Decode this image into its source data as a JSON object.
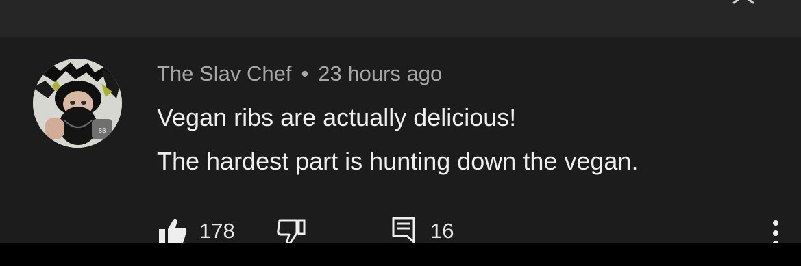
{
  "theme": {
    "background": "#1c1c1c",
    "top_bar": "#262626",
    "text_primary": "#efefef",
    "text_secondary": "#a7a7a7"
  },
  "header": {
    "back_icon": "arrow-left-icon",
    "close_icon": "close-icon"
  },
  "comment": {
    "author": "The Slav Chef",
    "separator": "•",
    "time": "23 hours ago",
    "lines": [
      "Vegan ribs are actually delicious!",
      "The hardest part is hunting down the vegan."
    ],
    "likes": "178",
    "replies": "16",
    "icons": {
      "like": "thumb-up-filled-icon",
      "dislike": "thumb-down-outline-icon",
      "replies": "comment-replies-icon",
      "menu": "more-vertical-icon"
    }
  }
}
